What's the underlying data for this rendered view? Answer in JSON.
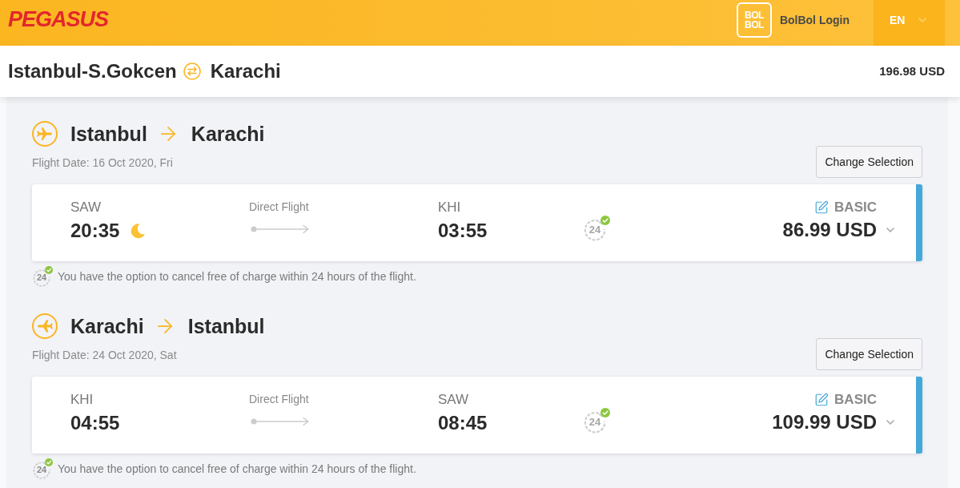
{
  "header": {
    "logo": "PEGASUS",
    "login": {
      "logo_text": "BOL BOL",
      "label": "BolBol Login"
    },
    "language": "EN"
  },
  "summary": {
    "origin": "Istanbul-S.Gokcen",
    "destination": "Karachi",
    "total": "196.98 USD"
  },
  "legs": [
    {
      "kind": "outbound",
      "from": "Istanbul",
      "to": "Karachi",
      "date": "Flight Date: 16 Oct 2020, Fri",
      "button": "Change Selection",
      "departure": {
        "code": "SAW",
        "time": "20:35",
        "night": true
      },
      "stops": "Direct Flight",
      "arrival": {
        "code": "KHI",
        "time": "03:55"
      },
      "cancel_badge": "24",
      "fare": "BASIC",
      "price": "86.99 USD",
      "note_badge": "24",
      "note": "You have the option to cancel free of charge within 24 hours of the flight."
    },
    {
      "kind": "return",
      "from": "Karachi",
      "to": "Istanbul",
      "date": "Flight Date: 24 Oct 2020, Sat",
      "button": "Change Selection",
      "departure": {
        "code": "KHI",
        "time": "04:55",
        "night": false
      },
      "stops": "Direct Flight",
      "arrival": {
        "code": "SAW",
        "time": "08:45"
      },
      "cancel_badge": "24",
      "fare": "BASIC",
      "price": "109.99 USD",
      "note_badge": "24",
      "note": "You have the option to cancel free of charge within 24 hours of the flight."
    }
  ]
}
